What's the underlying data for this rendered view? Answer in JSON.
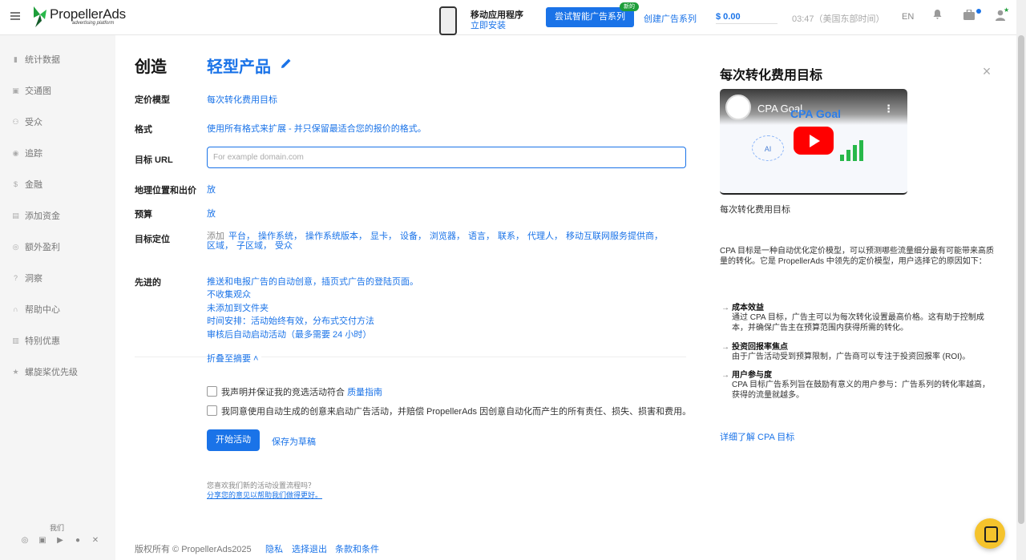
{
  "header": {
    "logo_name": "PropellerAds",
    "logo_sub": "advertising platform",
    "promo_title": "移动应用程序",
    "promo_link": "立即安装",
    "try_button": "尝试智能广告系列",
    "try_badge": "新的",
    "create_link": "创建广告系列",
    "balance": "$  0.00",
    "time": "03:47（美国东部时间）",
    "language": "EN"
  },
  "sidebar": {
    "items": [
      {
        "label": "统计数据",
        "icon": "bar-chart-icon"
      },
      {
        "label": "交通图",
        "icon": "map-icon"
      },
      {
        "label": "受众",
        "icon": "audience-icon"
      },
      {
        "label": "追踪",
        "icon": "eye-icon"
      },
      {
        "label": "金融",
        "icon": "dollar-icon"
      },
      {
        "label": "添加资金",
        "icon": "wallet-icon"
      },
      {
        "label": "额外盈利",
        "icon": "gift-icon"
      },
      {
        "label": "洞察",
        "icon": "help-circle-icon"
      },
      {
        "label": "帮助中心",
        "icon": "headset-icon"
      },
      {
        "label": "特别优惠",
        "icon": "bag-icon"
      },
      {
        "label": "螺旋桨优先级",
        "icon": "star-icon"
      }
    ],
    "us_label": "我们"
  },
  "form": {
    "title_create": "创造",
    "title_product": "轻型产品",
    "pricing_label": "定价模型",
    "pricing_value": "每次转化费用目标",
    "format_label": "格式",
    "format_value": "使用所有格式来扩展 - 并只保留最适合您的报价的格式。",
    "url_label": "目标 URL",
    "url_placeholder": "For example domain.com",
    "url_value": "",
    "geo_label": "地理位置和出价",
    "geo_value": "放",
    "budget_label": "预算",
    "budget_value": "放",
    "targeting_label": "目标定位",
    "targeting_prefix": "添加",
    "targeting_items": [
      "平台，",
      "操作系统，",
      "操作系统版本，",
      "显卡，",
      "设备，",
      "浏览器，",
      "语言，",
      "联系，",
      "代理人，",
      "移动互联网服务提供商，",
      "区域，",
      "子区域，",
      "受众"
    ],
    "advanced_label": "先进的",
    "advanced_items": [
      "推送和电报广告的自动创意，插页式广告的登陆页面。",
      "不收集观众",
      "未添加到文件夹",
      "时间安排：活动始终有效，分布式交付方法",
      "审核后自动启动活动（最多需要 24 小时）"
    ],
    "collapse": "折叠至摘要 ˄",
    "check1_text": "我声明并保证我的竞选活动符合 ",
    "check1_link": "质量指南",
    "check2_text": "我同意使用自动生成的创意来启动广告活动，并赔偿 PropellerAds 因创意自动化而产生的所有责任、损失、损害和费用。",
    "start_button": "开始活动",
    "draft_button": "保存为草稿",
    "feedback_q": "您喜欢我们新的活动设置流程吗？",
    "feedback_link": "分享您的意见以帮助我们做得更好。"
  },
  "footer": {
    "copyright": "版权所有 © PropellerAds2025",
    "privacy": "隐私",
    "optout": "选择退出",
    "terms": "条款和条件"
  },
  "panel": {
    "title": "每次转化费用目标",
    "video_title": "CPA Goal",
    "video_overlay": "CPA Goal",
    "video_ai": "AI",
    "caption": "每次转化费用目标",
    "intro": "CPA 目标是一种自动优化定价模型，可以预测哪些流量细分最有可能带来高质量的转化。它是 PropellerAds 中领先的定价模型，用户选择它的原因如下：",
    "points": [
      {
        "title": "成本效益",
        "desc": "通过 CPA 目标，广告主可以为每次转化设置最高价格。这有助于控制成本，并确保广告主在预算范围内获得所需的转化。"
      },
      {
        "title": "投资回报率焦点",
        "desc": "由于广告活动受到预算限制，广告商可以专注于投资回报率 (ROI)。"
      },
      {
        "title": "用户参与度",
        "desc": "CPA 目标广告系列旨在鼓励有意义的用户参与：广告系列的转化率越高，获得的流量就越多。"
      }
    ],
    "learn_more": "详细了解 CPA 目标"
  },
  "colors": {
    "accent": "#1a73e8",
    "badge": "#1e9e3a",
    "chat": "#f5c32c"
  }
}
